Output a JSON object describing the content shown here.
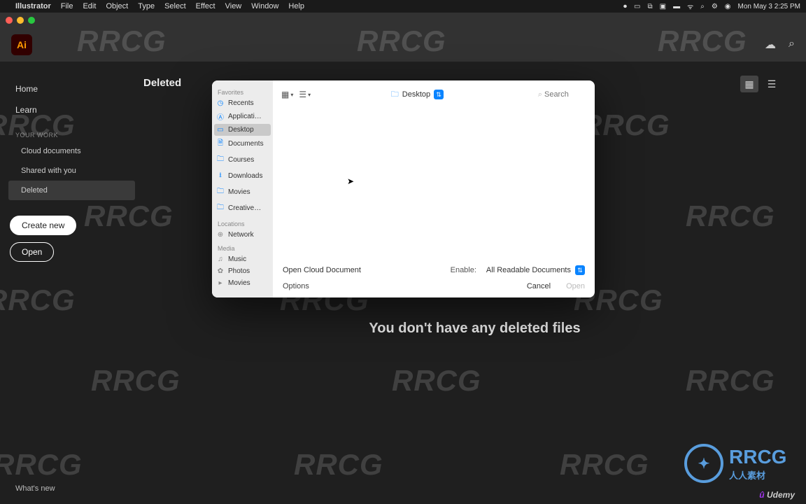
{
  "menubar": {
    "app": "Illustrator",
    "items": [
      "File",
      "Edit",
      "Object",
      "Type",
      "Select",
      "Effect",
      "View",
      "Window",
      "Help"
    ],
    "clock": "Mon May 3  2:25 PM"
  },
  "appheader": {
    "badge": "Ai"
  },
  "sidebar": {
    "home": "Home",
    "learn": "Learn",
    "section": "YOUR WORK",
    "cloud": "Cloud documents",
    "shared": "Shared with you",
    "deleted": "Deleted",
    "create": "Create new",
    "open": "Open",
    "whatsnew": "What's new"
  },
  "content": {
    "title": "Deleted",
    "empty": "You don't have any deleted files"
  },
  "dialog": {
    "sections": {
      "favorites": "Favorites",
      "locations": "Locations",
      "media": "Media"
    },
    "favorites": [
      {
        "icon": "clock",
        "label": "Recents"
      },
      {
        "icon": "app",
        "label": "Applicati…"
      },
      {
        "icon": "desktop",
        "label": "Desktop",
        "selected": true
      },
      {
        "icon": "doc",
        "label": "Documents"
      },
      {
        "icon": "folder",
        "label": "Courses"
      },
      {
        "icon": "download",
        "label": "Downloads"
      },
      {
        "icon": "folder",
        "label": "Movies"
      },
      {
        "icon": "folder",
        "label": "Creative…"
      }
    ],
    "locations": [
      {
        "icon": "globe",
        "label": "Network"
      }
    ],
    "media": [
      {
        "icon": "music",
        "label": "Music"
      },
      {
        "icon": "photos",
        "label": "Photos"
      },
      {
        "icon": "movies",
        "label": "Movies"
      }
    ],
    "location": "Desktop",
    "search_placeholder": "Search",
    "open_cloud": "Open Cloud Document",
    "enable_label": "Enable:",
    "enable_value": "All Readable Documents",
    "options": "Options",
    "cancel": "Cancel",
    "open": "Open"
  },
  "brand": {
    "wm": "RRCG",
    "wm_cn": "人人素材",
    "udemy": "Udemy"
  }
}
